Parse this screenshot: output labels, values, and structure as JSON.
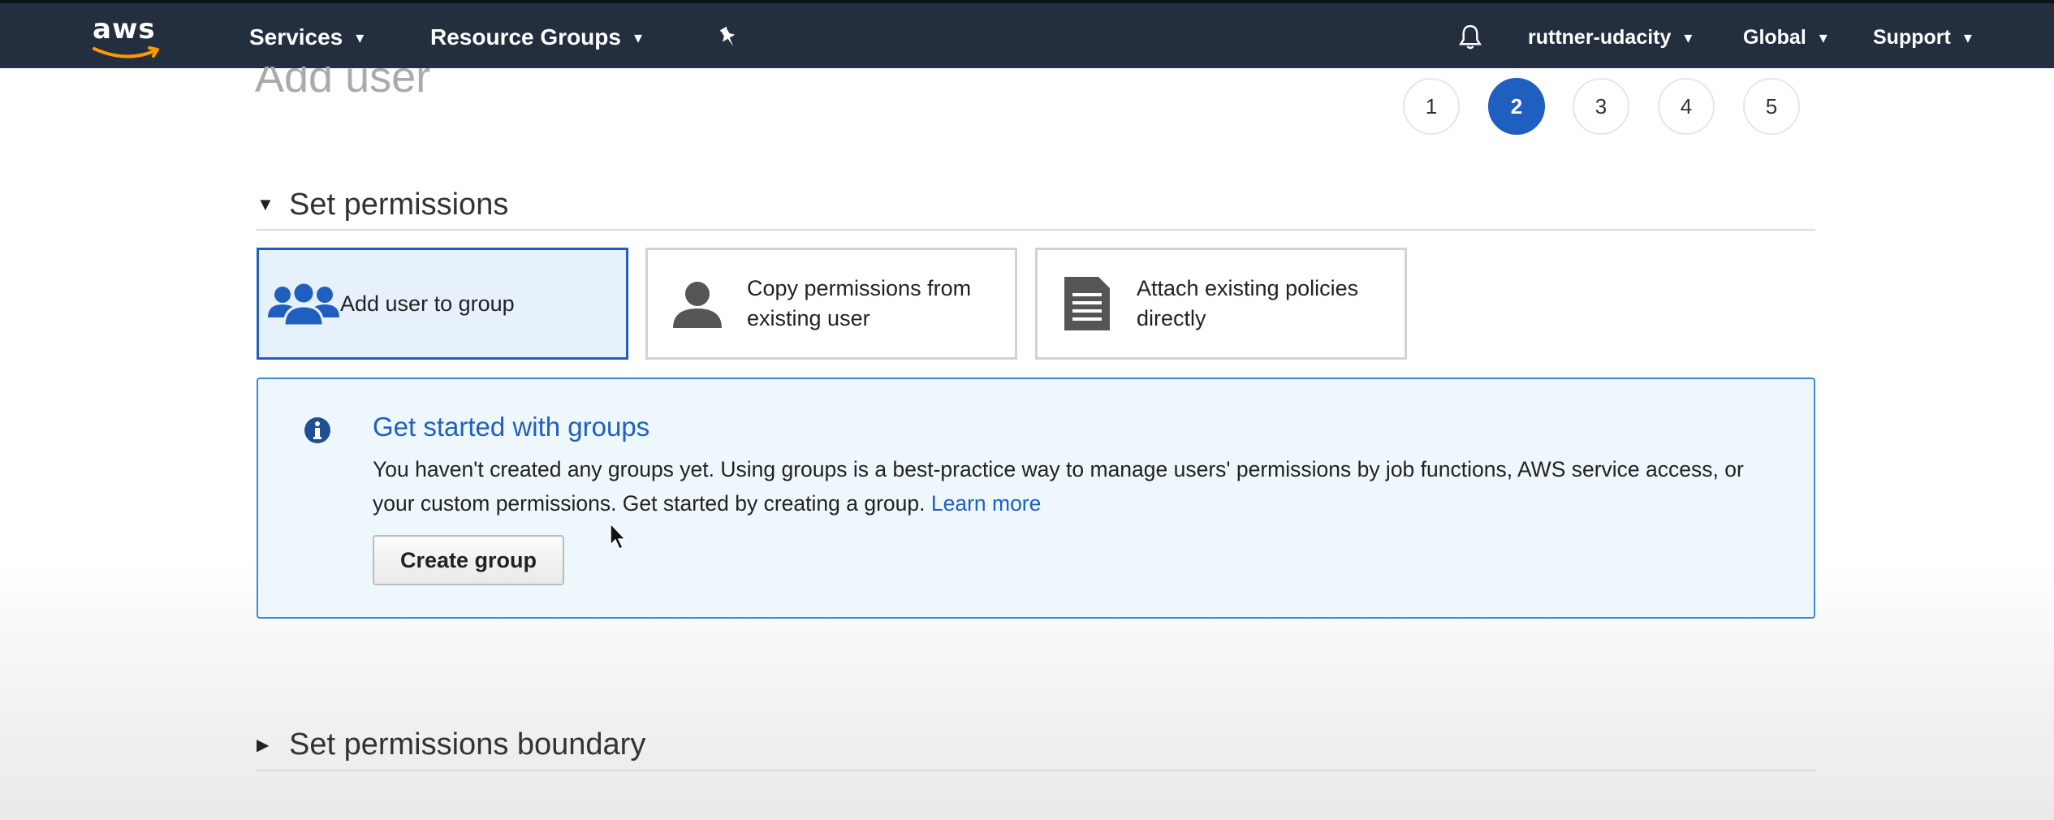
{
  "header": {
    "logo": "aws",
    "services": "Services",
    "resource_groups": "Resource Groups",
    "pin_icon": "pushpin-icon",
    "bell_icon": "bell-icon",
    "account": "ruttner-udacity",
    "region": "Global",
    "support": "Support",
    "chevron": "▾"
  },
  "page": {
    "title": "Add user",
    "steps": [
      "1",
      "2",
      "3",
      "4",
      "5"
    ],
    "active_step": "2"
  },
  "permissions": {
    "section_title": "Set permissions",
    "options": [
      {
        "label": "Add user to group",
        "icon": "users-group-icon",
        "selected": true
      },
      {
        "label": "Copy permissions from existing user",
        "icon": "user-icon",
        "selected": false
      },
      {
        "label": "Attach existing policies directly",
        "icon": "document-icon",
        "selected": false
      }
    ]
  },
  "info_box": {
    "icon": "info-icon",
    "title": "Get started with groups",
    "body": "You haven't created any groups yet. Using groups is a best-practice way to manage users' permissions by job functions, AWS service access, or your custom permissions. Get started by creating a group.",
    "link": "Learn more",
    "button": "Create group"
  },
  "boundary": {
    "section_title": "Set permissions boundary"
  },
  "colors": {
    "nav_bg": "#232f3e",
    "accent_blue": "#1f5fbf",
    "info_bg": "#eef7fc",
    "aws_orange": "#ff9900"
  }
}
